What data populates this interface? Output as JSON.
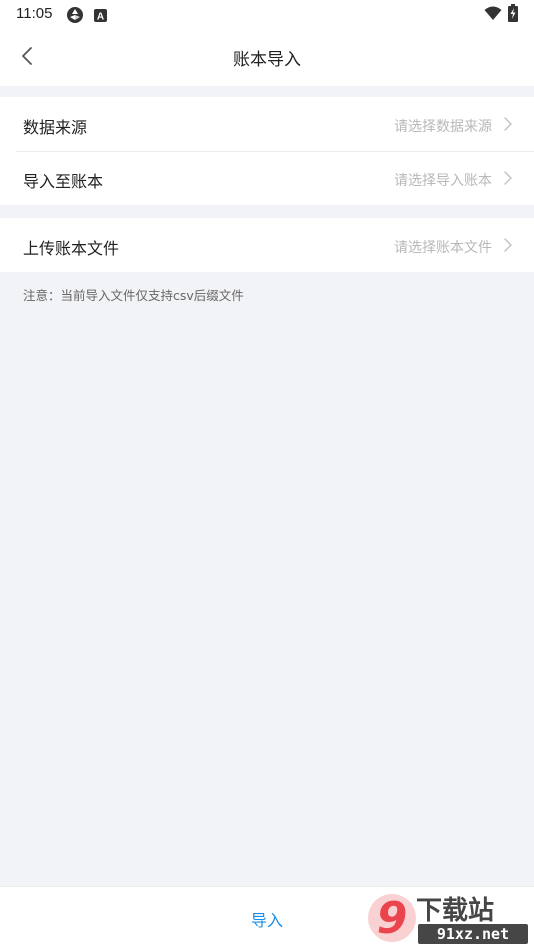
{
  "status_bar": {
    "time": "11:05",
    "icons": [
      "sync-icon",
      "a-badge-icon",
      "wifi-icon",
      "battery-charging-icon"
    ]
  },
  "header": {
    "title": "账本导入",
    "back_icon": "chevron-left-icon"
  },
  "sections": [
    {
      "rows": [
        {
          "label": "数据来源",
          "value": "请选择数据来源"
        },
        {
          "label": "导入至账本",
          "value": "请选择导入账本"
        }
      ]
    },
    {
      "rows": [
        {
          "label": "上传账本文件",
          "value": "请选择账本文件"
        }
      ]
    }
  ],
  "note": "注意：当前导入文件仅支持csv后缀文件",
  "footer": {
    "import_label": "导入"
  },
  "watermark": {
    "text_top": "下载站",
    "text_bottom": "91xz.net",
    "logo_glyph": "9"
  },
  "colors": {
    "background": "#f2f3f7",
    "accent": "#1a8ee6",
    "placeholder": "#b8b8b8",
    "watermark_red": "#e8313a"
  }
}
